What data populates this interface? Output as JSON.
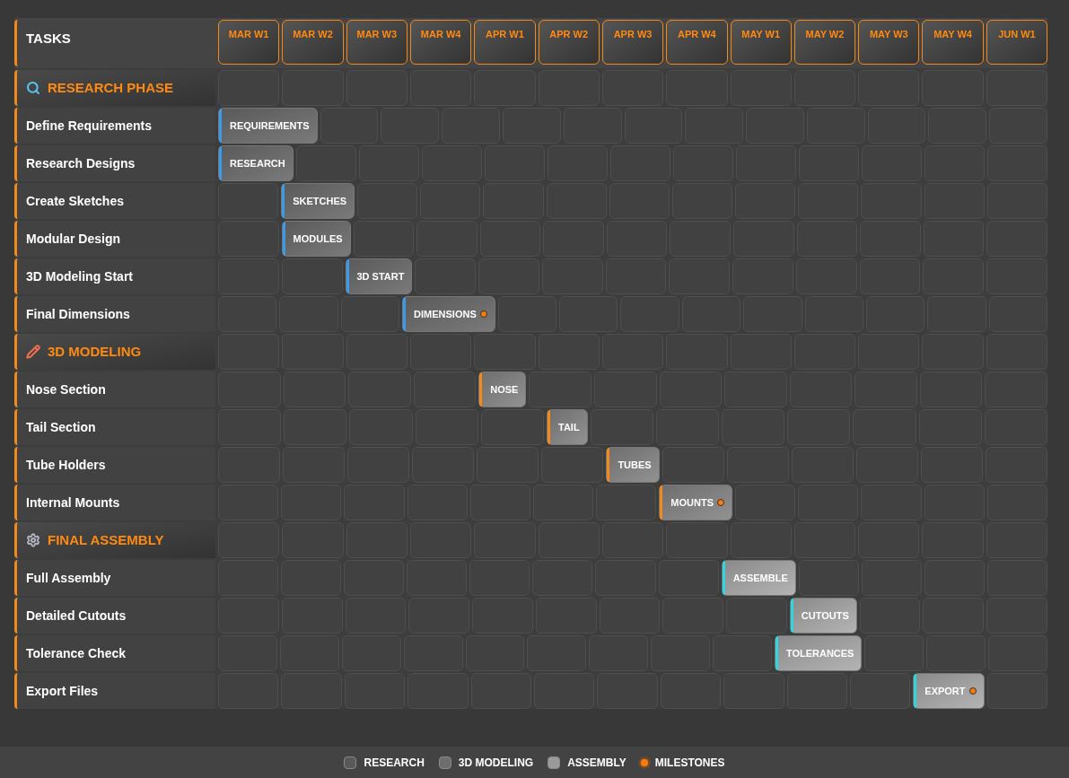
{
  "header": {
    "title": "TASKS",
    "weeks": [
      "MAR W1",
      "MAR W2",
      "MAR W3",
      "MAR W4",
      "APR W1",
      "APR W2",
      "APR W3",
      "APR W4",
      "MAY W1",
      "MAY W2",
      "MAY W3",
      "MAY W4",
      "JUN W1"
    ]
  },
  "rows": [
    {
      "kind": "phase",
      "label": "RESEARCH PHASE",
      "cells": [
        {
          "kind": "empty"
        },
        {
          "kind": "empty"
        },
        {
          "kind": "empty"
        },
        {
          "kind": "empty"
        },
        {
          "kind": "empty"
        },
        {
          "kind": "empty"
        },
        {
          "kind": "empty"
        },
        {
          "kind": "empty"
        },
        {
          "kind": "empty"
        },
        {
          "kind": "empty"
        },
        {
          "kind": "empty"
        },
        {
          "kind": "empty"
        },
        {
          "kind": "empty"
        }
      ]
    },
    {
      "kind": "task",
      "label": "Define Requirements",
      "cells": [
        {
          "kind": "bar",
          "label": "REQUIREMENTS",
          "milestone": false,
          "color": "#3b9be8"
        },
        {
          "kind": "empty"
        },
        {
          "kind": "empty"
        },
        {
          "kind": "empty"
        },
        {
          "kind": "empty"
        },
        {
          "kind": "empty"
        },
        {
          "kind": "empty"
        },
        {
          "kind": "empty"
        },
        {
          "kind": "empty"
        },
        {
          "kind": "empty"
        },
        {
          "kind": "empty"
        },
        {
          "kind": "empty"
        },
        {
          "kind": "empty"
        }
      ]
    },
    {
      "kind": "task",
      "label": "Research Designs",
      "cells": [
        {
          "kind": "bar",
          "label": "RESEARCH",
          "milestone": false,
          "color": "#3b9be8"
        },
        {
          "kind": "empty"
        },
        {
          "kind": "empty"
        },
        {
          "kind": "empty"
        },
        {
          "kind": "empty"
        },
        {
          "kind": "empty"
        },
        {
          "kind": "empty"
        },
        {
          "kind": "empty"
        },
        {
          "kind": "empty"
        },
        {
          "kind": "empty"
        },
        {
          "kind": "empty"
        },
        {
          "kind": "empty"
        },
        {
          "kind": "empty"
        }
      ]
    },
    {
      "kind": "task",
      "label": "Create Sketches",
      "cells": [
        {
          "kind": "empty"
        },
        {
          "kind": "bar",
          "label": "SKETCHES",
          "milestone": false,
          "color": "#3b9be8"
        },
        {
          "kind": "empty"
        },
        {
          "kind": "empty"
        },
        {
          "kind": "empty"
        },
        {
          "kind": "empty"
        },
        {
          "kind": "empty"
        },
        {
          "kind": "empty"
        },
        {
          "kind": "empty"
        },
        {
          "kind": "empty"
        },
        {
          "kind": "empty"
        },
        {
          "kind": "empty"
        },
        {
          "kind": "empty"
        }
      ]
    },
    {
      "kind": "task",
      "label": "Modular Design",
      "cells": [
        {
          "kind": "empty"
        },
        {
          "kind": "bar",
          "label": "MODULES",
          "milestone": false,
          "color": "#3b9be8"
        },
        {
          "kind": "empty"
        },
        {
          "kind": "empty"
        },
        {
          "kind": "empty"
        },
        {
          "kind": "empty"
        },
        {
          "kind": "empty"
        },
        {
          "kind": "empty"
        },
        {
          "kind": "empty"
        },
        {
          "kind": "empty"
        },
        {
          "kind": "empty"
        },
        {
          "kind": "empty"
        },
        {
          "kind": "empty"
        }
      ]
    },
    {
      "kind": "task",
      "label": "3D Modeling Start",
      "cells": [
        {
          "kind": "empty"
        },
        {
          "kind": "empty"
        },
        {
          "kind": "bar",
          "label": "3D START",
          "milestone": false,
          "color": "#3b9be8"
        },
        {
          "kind": "empty"
        },
        {
          "kind": "empty"
        },
        {
          "kind": "empty"
        },
        {
          "kind": "empty"
        },
        {
          "kind": "empty"
        },
        {
          "kind": "empty"
        },
        {
          "kind": "empty"
        },
        {
          "kind": "empty"
        },
        {
          "kind": "empty"
        },
        {
          "kind": "empty"
        }
      ]
    },
    {
      "kind": "task",
      "label": "Final Dimensions",
      "cells": [
        {
          "kind": "empty"
        },
        {
          "kind": "empty"
        },
        {
          "kind": "empty"
        },
        {
          "kind": "bar",
          "label": "DIMENSIONS",
          "milestone": true,
          "color": "#3b9be8"
        },
        {
          "kind": "empty"
        },
        {
          "kind": "empty"
        },
        {
          "kind": "empty"
        },
        {
          "kind": "empty"
        },
        {
          "kind": "empty"
        },
        {
          "kind": "empty"
        },
        {
          "kind": "empty"
        },
        {
          "kind": "empty"
        },
        {
          "kind": "empty"
        }
      ]
    },
    {
      "kind": "phase",
      "label": "3D MODELING",
      "cells": [
        {
          "kind": "empty"
        },
        {
          "kind": "empty"
        },
        {
          "kind": "empty"
        },
        {
          "kind": "empty"
        },
        {
          "kind": "empty"
        },
        {
          "kind": "empty"
        },
        {
          "kind": "empty"
        },
        {
          "kind": "empty"
        },
        {
          "kind": "empty"
        },
        {
          "kind": "empty"
        },
        {
          "kind": "empty"
        },
        {
          "kind": "empty"
        },
        {
          "kind": "empty"
        }
      ]
    },
    {
      "kind": "task",
      "label": "Nose Section",
      "cells": [
        {
          "kind": "empty"
        },
        {
          "kind": "empty"
        },
        {
          "kind": "empty"
        },
        {
          "kind": "empty"
        },
        {
          "kind": "bar",
          "label": "NOSE",
          "milestone": false,
          "color": "#f28a1a"
        },
        {
          "kind": "empty"
        },
        {
          "kind": "empty"
        },
        {
          "kind": "empty"
        },
        {
          "kind": "empty"
        },
        {
          "kind": "empty"
        },
        {
          "kind": "empty"
        },
        {
          "kind": "empty"
        },
        {
          "kind": "empty"
        }
      ]
    },
    {
      "kind": "task",
      "label": "Tail Section",
      "cells": [
        {
          "kind": "empty"
        },
        {
          "kind": "empty"
        },
        {
          "kind": "empty"
        },
        {
          "kind": "empty"
        },
        {
          "kind": "empty"
        },
        {
          "kind": "bar",
          "label": "TAIL",
          "milestone": false,
          "color": "#f28a1a"
        },
        {
          "kind": "empty"
        },
        {
          "kind": "empty"
        },
        {
          "kind": "empty"
        },
        {
          "kind": "empty"
        },
        {
          "kind": "empty"
        },
        {
          "kind": "empty"
        },
        {
          "kind": "empty"
        }
      ]
    },
    {
      "kind": "task",
      "label": "Tube Holders",
      "cells": [
        {
          "kind": "empty"
        },
        {
          "kind": "empty"
        },
        {
          "kind": "empty"
        },
        {
          "kind": "empty"
        },
        {
          "kind": "empty"
        },
        {
          "kind": "empty"
        },
        {
          "kind": "bar",
          "label": "TUBES",
          "milestone": false,
          "color": "#f28a1a"
        },
        {
          "kind": "empty"
        },
        {
          "kind": "empty"
        },
        {
          "kind": "empty"
        },
        {
          "kind": "empty"
        },
        {
          "kind": "empty"
        },
        {
          "kind": "empty"
        }
      ]
    },
    {
      "kind": "task",
      "label": "Internal Mounts",
      "cells": [
        {
          "kind": "empty"
        },
        {
          "kind": "empty"
        },
        {
          "kind": "empty"
        },
        {
          "kind": "empty"
        },
        {
          "kind": "empty"
        },
        {
          "kind": "empty"
        },
        {
          "kind": "empty"
        },
        {
          "kind": "bar",
          "label": "MOUNTS",
          "milestone": true,
          "color": "#f28a1a"
        },
        {
          "kind": "empty"
        },
        {
          "kind": "empty"
        },
        {
          "kind": "empty"
        },
        {
          "kind": "empty"
        },
        {
          "kind": "empty"
        }
      ]
    },
    {
      "kind": "phase",
      "label": "FINAL ASSEMBLY",
      "cells": [
        {
          "kind": "empty"
        },
        {
          "kind": "empty"
        },
        {
          "kind": "empty"
        },
        {
          "kind": "empty"
        },
        {
          "kind": "empty"
        },
        {
          "kind": "empty"
        },
        {
          "kind": "empty"
        },
        {
          "kind": "empty"
        },
        {
          "kind": "empty"
        },
        {
          "kind": "empty"
        },
        {
          "kind": "empty"
        },
        {
          "kind": "empty"
        },
        {
          "kind": "empty"
        }
      ]
    },
    {
      "kind": "task",
      "label": "Full Assembly",
      "cells": [
        {
          "kind": "empty"
        },
        {
          "kind": "empty"
        },
        {
          "kind": "empty"
        },
        {
          "kind": "empty"
        },
        {
          "kind": "empty"
        },
        {
          "kind": "empty"
        },
        {
          "kind": "empty"
        },
        {
          "kind": "empty"
        },
        {
          "kind": "bar",
          "label": "ASSEMBLE",
          "milestone": false,
          "color": "#2fd6e0"
        },
        {
          "kind": "empty"
        },
        {
          "kind": "empty"
        },
        {
          "kind": "empty"
        },
        {
          "kind": "empty"
        }
      ]
    },
    {
      "kind": "task",
      "label": "Detailed Cutouts",
      "cells": [
        {
          "kind": "empty"
        },
        {
          "kind": "empty"
        },
        {
          "kind": "empty"
        },
        {
          "kind": "empty"
        },
        {
          "kind": "empty"
        },
        {
          "kind": "empty"
        },
        {
          "kind": "empty"
        },
        {
          "kind": "empty"
        },
        {
          "kind": "empty"
        },
        {
          "kind": "bar",
          "label": "CUTOUTS",
          "milestone": false,
          "color": "#2fd6e0"
        },
        {
          "kind": "empty"
        },
        {
          "kind": "empty"
        },
        {
          "kind": "empty"
        }
      ]
    },
    {
      "kind": "task",
      "label": "Tolerance Check",
      "cells": [
        {
          "kind": "empty"
        },
        {
          "kind": "empty"
        },
        {
          "kind": "empty"
        },
        {
          "kind": "empty"
        },
        {
          "kind": "empty"
        },
        {
          "kind": "empty"
        },
        {
          "kind": "empty"
        },
        {
          "kind": "empty"
        },
        {
          "kind": "empty"
        },
        {
          "kind": "bar",
          "label": "TOLERANCES",
          "milestone": false,
          "color": "#2fd6e0"
        },
        {
          "kind": "empty"
        },
        {
          "kind": "empty"
        },
        {
          "kind": "empty"
        }
      ]
    },
    {
      "kind": "task",
      "label": "Export Files",
      "cells": [
        {
          "kind": "empty"
        },
        {
          "kind": "empty"
        },
        {
          "kind": "empty"
        },
        {
          "kind": "empty"
        },
        {
          "kind": "empty"
        },
        {
          "kind": "empty"
        },
        {
          "kind": "empty"
        },
        {
          "kind": "empty"
        },
        {
          "kind": "empty"
        },
        {
          "kind": "empty"
        },
        {
          "kind": "empty"
        },
        {
          "kind": "bar",
          "label": "EXPORT",
          "milestone": true,
          "color": "#2fd6e0"
        },
        {
          "kind": "empty"
        }
      ]
    }
  ],
  "legend": [
    {
      "kind": "research",
      "label": "RESEARCH"
    },
    {
      "kind": "modeling",
      "label": "3D MODELING"
    },
    {
      "kind": "assembly",
      "label": "ASSEMBLY"
    },
    {
      "kind": "milestone",
      "label": "MILESTONES"
    }
  ]
}
